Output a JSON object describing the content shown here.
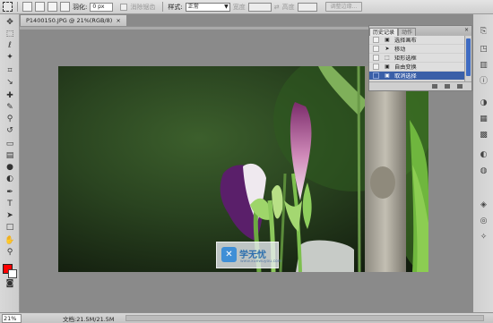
{
  "options_bar": {
    "feather_label": "羽化:",
    "feather_value": "0 px",
    "antialias_label": "消除锯齿",
    "style_label": "样式:",
    "style_value": "正常",
    "width_label": "宽度",
    "height_label": "高度",
    "refine_edge_label": "调整边缘..."
  },
  "document": {
    "tab_title": "P1400150.JPG @ 21%(RGB/8)",
    "tab_close": "×"
  },
  "history_panel": {
    "tabs": [
      "历史记录",
      "动作"
    ],
    "close_glyph": "×",
    "items": [
      {
        "label": "选择画布",
        "icon": "step-icon"
      },
      {
        "label": "移动",
        "icon": "move-icon"
      },
      {
        "label": "矩形选框",
        "icon": "marquee-icon"
      },
      {
        "label": "自由变换",
        "icon": "transform-icon"
      },
      {
        "label": "取消选择",
        "icon": "deselect-icon",
        "selected": true
      }
    ]
  },
  "watermark": {
    "logo_glyph": "✕",
    "name": "学无忧",
    "url": "www.xuewuyou.com"
  },
  "status_bar": {
    "zoom": "21%",
    "doc_info": "文档:21.5M/21.5M",
    "arrow": "▶"
  },
  "colors": {
    "foreground": "#ff0000",
    "background": "#ffffff",
    "selection_highlight": "#3a5fa8"
  }
}
